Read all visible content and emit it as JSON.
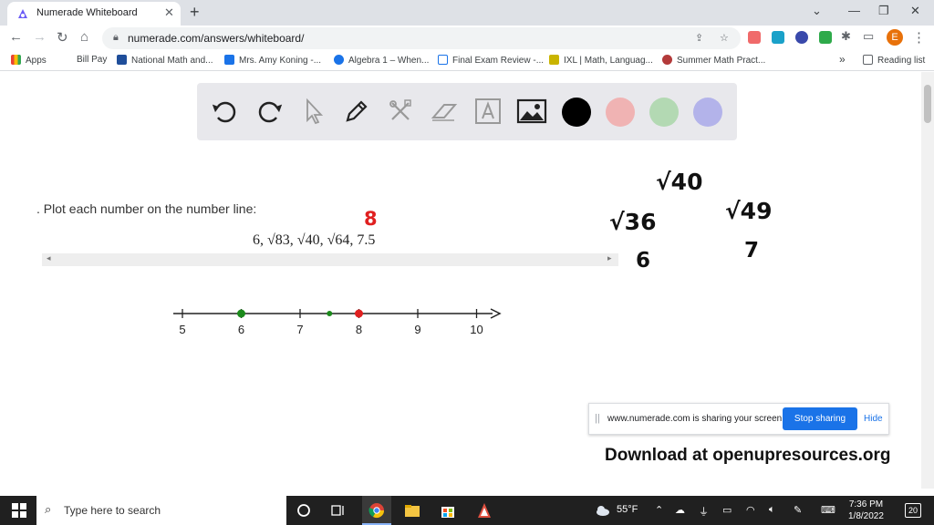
{
  "browser": {
    "tab": {
      "title": "Numerade Whiteboard",
      "close": "✕"
    },
    "new_tab": "+",
    "window_controls": {
      "minimize": "—",
      "restore": "❐",
      "close": "✕",
      "menu": "⌄"
    },
    "url": "numerade.com/answers/whiteboard/",
    "profile_initial": "E",
    "bookmarks": [
      {
        "label": "Apps",
        "icon": "apps-grid-icon",
        "color": "#ea4335"
      },
      {
        "label": "Bill Pay",
        "icon": "",
        "color": ""
      },
      {
        "label": "National Math and...",
        "icon": "x-logo-icon",
        "color": "#1f4e9a"
      },
      {
        "label": "Mrs. Amy Koning -...",
        "icon": "calendar-icon",
        "color": "#1a73e8"
      },
      {
        "label": "Algebra 1 – When...",
        "icon": "globe-icon",
        "color": "#1a73e8"
      },
      {
        "label": "Final Exam Review -...",
        "icon": "doc-icon",
        "color": "#1a73e8"
      },
      {
        "label": "IXL | Math, Languag...",
        "icon": "ixl-icon",
        "color": "#c9b400"
      },
      {
        "label": "Summer Math Pract...",
        "icon": "circle-logo-icon",
        "color": "#b33a3a"
      }
    ],
    "more_bookmarks": "»",
    "reading_list": "Reading list"
  },
  "whiteboard": {
    "tools": [
      "undo-icon",
      "redo-icon",
      "pointer-icon",
      "pen-icon",
      "tools-icon",
      "eraser-icon",
      "text-icon",
      "image-icon"
    ],
    "colors": [
      "#000000",
      "#f0b3b3",
      "#b3d9b3",
      "#b3b3ea"
    ]
  },
  "question": {
    "text": ". Plot each number on the number line:",
    "expression": "6, √83, √40, √64, 7.5",
    "scroll_left": "◂",
    "scroll_right": "▸"
  },
  "number_line": {
    "ticks": [
      "5",
      "6",
      "7",
      "8",
      "9",
      "10"
    ],
    "points": [
      {
        "value": 6,
        "color": "#1b8a1b"
      },
      {
        "value": 7.5,
        "color": "#1b8a1b"
      },
      {
        "value": 8,
        "color": "#e02020"
      }
    ]
  },
  "annotations": {
    "red_note": "8",
    "handwriting": [
      "√40",
      "√36",
      "6",
      "√49",
      "7"
    ]
  },
  "share_banner": {
    "grip": "||",
    "text": "www.numerade.com is sharing your screen.",
    "stop": "Stop sharing",
    "hide": "Hide"
  },
  "watermark": "Download at openupresources.org",
  "taskbar": {
    "search_placeholder": "Type here to search",
    "weather": "55°F",
    "time": "7:36 PM",
    "date": "1/8/2022",
    "notification_count": "20"
  }
}
